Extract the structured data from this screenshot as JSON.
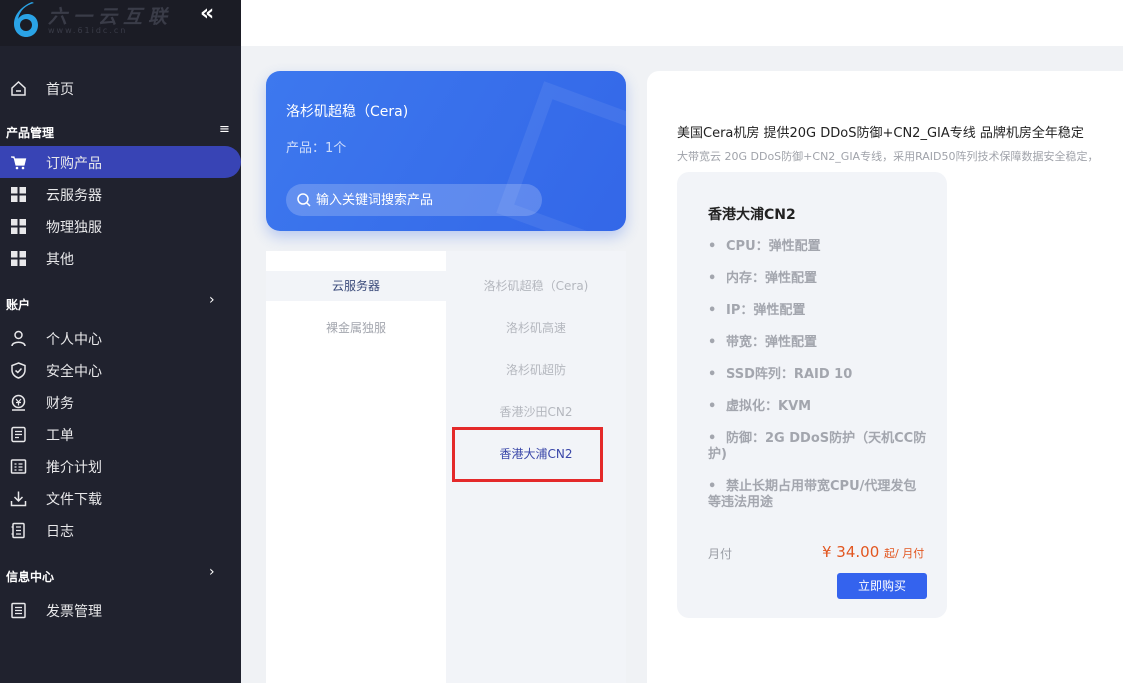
{
  "brand": {
    "logo_text": "六一云互联",
    "logo_sub": "www.61idc.cn"
  },
  "sidebar": {
    "home": "首页",
    "product_section": "产品管理",
    "products": [
      {
        "label": "订购产品",
        "icon": "cart-icon"
      },
      {
        "label": "云服务器",
        "icon": "grid-icon"
      },
      {
        "label": "物理独服",
        "icon": "grid-icon"
      },
      {
        "label": "其他",
        "icon": "grid-icon"
      }
    ],
    "account_section": "账户",
    "account": [
      {
        "label": "个人中心",
        "icon": "user-icon"
      },
      {
        "label": "安全中心",
        "icon": "shield-icon"
      },
      {
        "label": "财务",
        "icon": "finance-icon"
      },
      {
        "label": "工单",
        "icon": "ticket-icon"
      },
      {
        "label": "推介计划",
        "icon": "referral-icon"
      },
      {
        "label": "文件下载",
        "icon": "download-icon"
      },
      {
        "label": "日志",
        "icon": "log-icon"
      }
    ],
    "info_section": "信息中心",
    "info": [
      {
        "label": "发票管理",
        "icon": "invoice-icon"
      }
    ]
  },
  "group_card": {
    "title": "洛杉矶超稳（Cera)",
    "count": "产品：1个",
    "search_placeholder": "输入关键词搜索产品"
  },
  "categories": [
    "云服务器",
    "裸金属独服"
  ],
  "subgroups": [
    "洛杉矶超稳（Cera)",
    "洛杉矶高速",
    "洛杉矶超防",
    "香港沙田CN2",
    "香港大浦CN2"
  ],
  "content": {
    "title": "美国Cera机房 提供20G DDoS防御+CN2_GIA专线 品牌机房全年稳定",
    "desc": "大带宽云 20G DDoS防御+CN2_GIA专线，采用RAID50阵列技术保障数据安全稳定，"
  },
  "product": {
    "name": "香港大浦CN2",
    "specs": [
      "CPU：弹性配置",
      "内存：弹性配置",
      "IP：弹性配置",
      "带宽：弹性配置",
      "SSD阵列：RAID 10",
      "虚拟化：KVM",
      "防御：2G DDoS防护（天机CC防护)",
      "禁止长期占用带宽CPU/代理发包等违法用途"
    ],
    "period": "月付",
    "price": "¥ 34.00",
    "price_unit": "起/ 月付",
    "buy_label": "立即购买"
  },
  "colors": {
    "sidebar_bg": "#20222e",
    "active_nav": "#3844b5",
    "brand_blue": "#3367e8",
    "price_red": "#e25620",
    "highlight_red": "#e4292a"
  }
}
